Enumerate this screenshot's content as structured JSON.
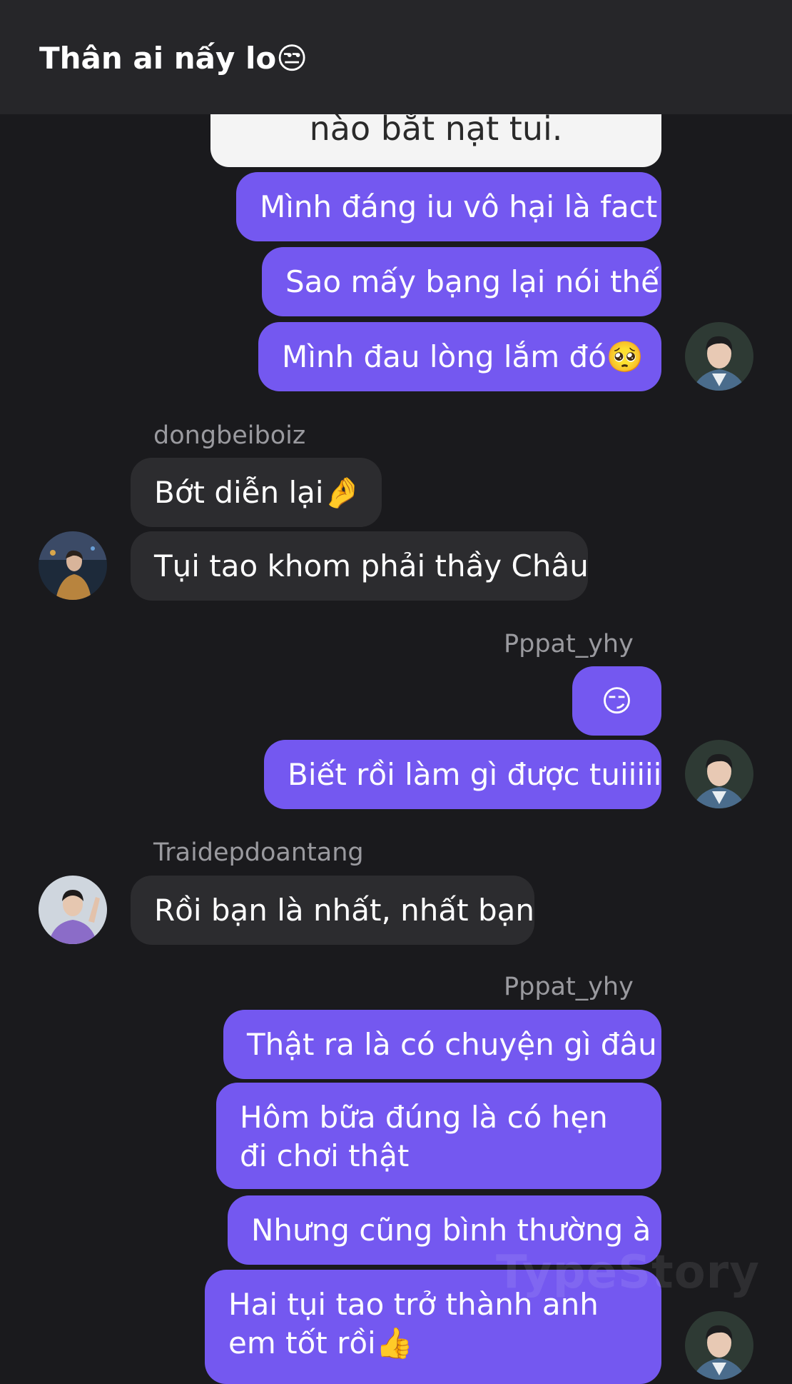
{
  "header": {
    "title": "Thân ai nấy lo😒"
  },
  "image_message": {
    "text": "nào bắt nạt tui."
  },
  "messages": {
    "m1": "Mình đáng iu vô hại là fact",
    "m2": "Sao mấy bạng lại nói thế",
    "m3": "Mình đau lòng lắm đó🥺",
    "m4": "Bớt diễn lại🤌",
    "m5": "Tụi tao khom phải thầy Châu",
    "m6": "😏",
    "m7": "Biết rồi làm gì được tuiiiii",
    "m8": "Rồi bạn là nhất, nhất bạn",
    "m9": "Thật ra là có chuyện gì đâu",
    "m10": "Hôm bữa đúng là có hẹn đi chơi thật",
    "m11": "Nhưng cũng bình thường à",
    "m12": "Hai tụi tao trở thành anh em tốt rồi👍"
  },
  "senders": {
    "s1": "dongbeiboiz",
    "s2": "Pppat_yhy",
    "s3": "Traidepdoantang",
    "s4": "Pppat_yhy"
  },
  "watermark": "TypeStory"
}
